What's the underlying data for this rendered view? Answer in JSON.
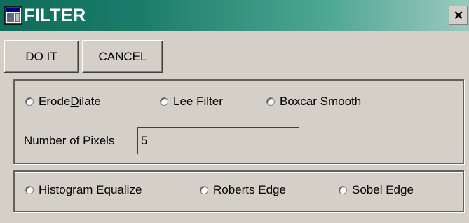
{
  "window": {
    "title": "FILTER",
    "close_glyph": "×",
    "icon": "app-window-icon"
  },
  "buttons": {
    "do_it": "DO IT",
    "cancel": "CANCEL"
  },
  "morphology_group": {
    "options": [
      {
        "label_pre": "Erode",
        "label_ul": "D",
        "label_post": "ilate"
      },
      {
        "label": "Lee Filter"
      },
      {
        "label": "Boxcar Smooth"
      }
    ],
    "pixels_label": "Number of Pixels",
    "pixels_value": "5"
  },
  "edge_group": {
    "options": [
      {
        "label": "Histogram Equalize"
      },
      {
        "label": "Roberts Edge"
      },
      {
        "label": "Sobel Edge"
      }
    ]
  },
  "colors": {
    "titlebar_start": "#0f6b5a",
    "titlebar_end": "#9cc9bf",
    "face": "#d4d0c8"
  }
}
